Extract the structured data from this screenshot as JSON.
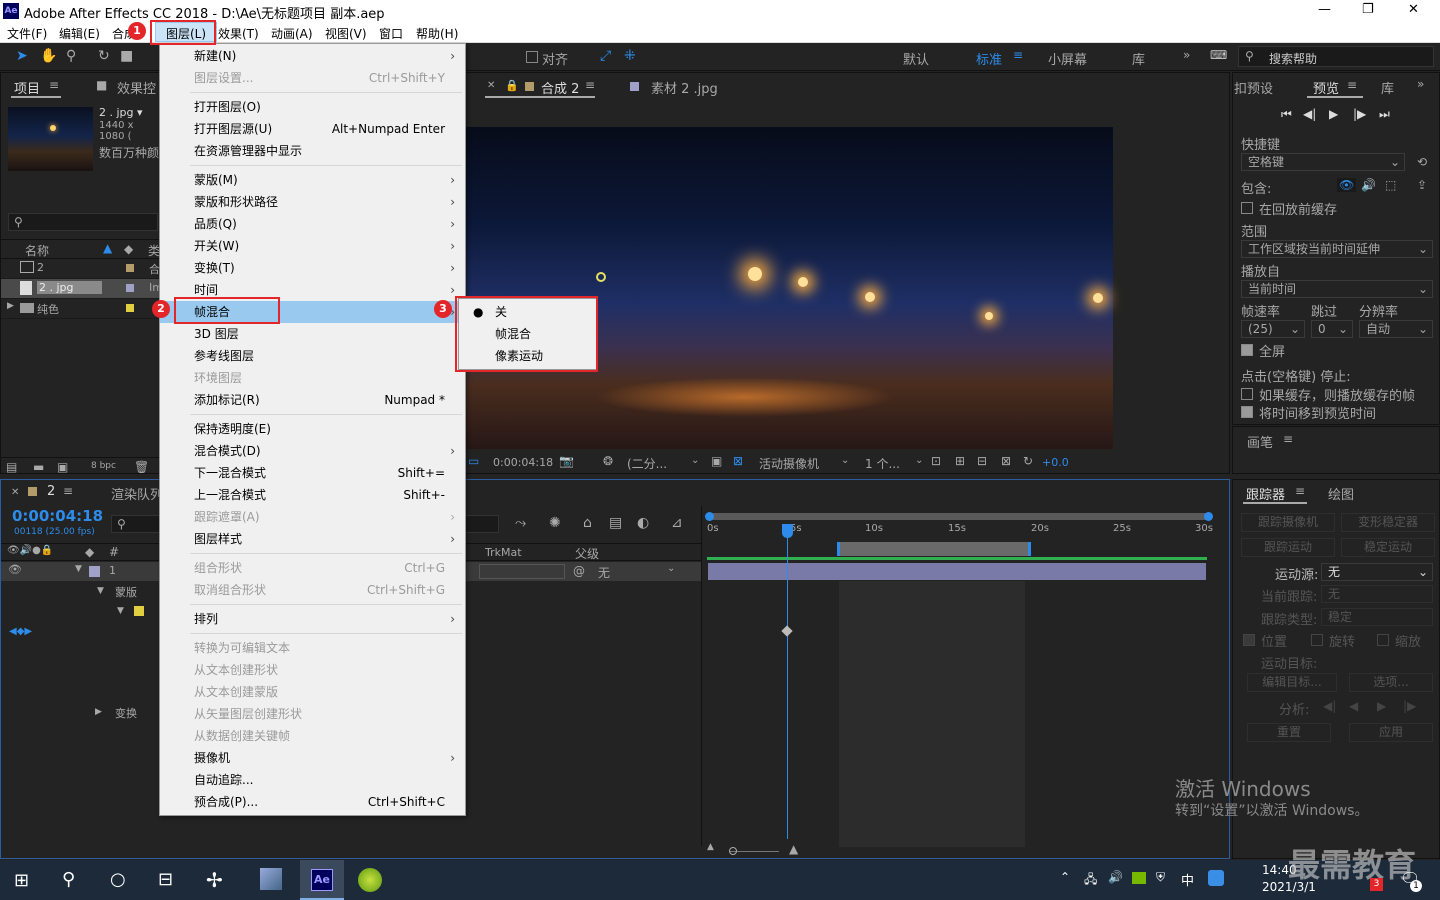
{
  "window": {
    "title": "Adobe After Effects CC 2018 - D:\\Ae\\无标题项目 副本.aep",
    "app_icon": "Ae",
    "min": "—",
    "max": "❐",
    "close": "✕"
  },
  "menubar": [
    "文件(F)",
    "编辑(E)",
    "合成",
    "图层(L)",
    "效果(T)",
    "动画(A)",
    "视图(V)",
    "窗口",
    "帮助(H)"
  ],
  "toolbar": {
    "snap_label": "对齐",
    "workspaces": [
      "默认",
      "标准",
      "小屏幕",
      "库"
    ],
    "search_placeholder": "搜索帮助"
  },
  "project": {
    "tab_project": "项目",
    "tab_effects": "效果控",
    "thumb_name": "2 . jpg ▾",
    "thumb_dims": "1440 x 1080 (",
    "thumb_desc": "数百万种颜",
    "col_name": "名称",
    "col_type": "类",
    "rows": [
      {
        "name": "2",
        "type": "合"
      },
      {
        "name": "2 . jpg",
        "type": "Im"
      },
      {
        "name": "纯色",
        "type": ""
      }
    ],
    "bpc": "8 bpc"
  },
  "comp": {
    "tab1": "合成 2",
    "tab2": "素材 2 .jpg",
    "timecode": "0:00:04:18",
    "resolution": "(二分...",
    "camera": "活动摄像机",
    "views": "1 个...",
    "exposure": "+0.0"
  },
  "timeline": {
    "tab": "2",
    "tab2": "渲染队列",
    "timecode": "0:00:04:18",
    "frames": "00118 (25.00 fps)",
    "col_trkmat": "TrkMat",
    "col_parent": "父级",
    "layer_num": "1",
    "parent_value": "无",
    "sub_mask": "蒙版",
    "sub_transform": "变换",
    "ruler": [
      "0s",
      "5s",
      "10s",
      "15s",
      "20s",
      "25s",
      "30s"
    ]
  },
  "layer_menu": {
    "items": [
      {
        "label": "新建(N)",
        "shortcut": "",
        "arrow": true,
        "disabled": false
      },
      {
        "label": "图层设置...",
        "shortcut": "Ctrl+Shift+Y",
        "arrow": false,
        "disabled": true
      },
      {
        "label": "打开图层(O)",
        "shortcut": "",
        "arrow": false,
        "disabled": false
      },
      {
        "label": "打开图层源(U)",
        "shortcut": "Alt+Numpad Enter",
        "arrow": false,
        "disabled": false
      },
      {
        "label": "在资源管理器中显示",
        "shortcut": "",
        "arrow": false,
        "disabled": false
      },
      {
        "label": "蒙版(M)",
        "shortcut": "",
        "arrow": true,
        "disabled": false
      },
      {
        "label": "蒙版和形状路径",
        "shortcut": "",
        "arrow": true,
        "disabled": false
      },
      {
        "label": "品质(Q)",
        "shortcut": "",
        "arrow": true,
        "disabled": false
      },
      {
        "label": "开关(W)",
        "shortcut": "",
        "arrow": true,
        "disabled": false
      },
      {
        "label": "变换(T)",
        "shortcut": "",
        "arrow": true,
        "disabled": false
      },
      {
        "label": "时间",
        "shortcut": "",
        "arrow": true,
        "disabled": false
      },
      {
        "label": "帧混合",
        "shortcut": "",
        "arrow": true,
        "disabled": false
      },
      {
        "label": "3D 图层",
        "shortcut": "",
        "arrow": false,
        "disabled": false
      },
      {
        "label": "参考线图层",
        "shortcut": "",
        "arrow": false,
        "disabled": false
      },
      {
        "label": "环境图层",
        "shortcut": "",
        "arrow": false,
        "disabled": true
      },
      {
        "label": "添加标记(R)",
        "shortcut": "Numpad *",
        "arrow": false,
        "disabled": false
      },
      {
        "label": "保持透明度(E)",
        "shortcut": "",
        "arrow": false,
        "disabled": false
      },
      {
        "label": "混合模式(D)",
        "shortcut": "",
        "arrow": true,
        "disabled": false
      },
      {
        "label": "下一混合模式",
        "shortcut": "Shift+=",
        "arrow": false,
        "disabled": false
      },
      {
        "label": "上一混合模式",
        "shortcut": "Shift+-",
        "arrow": false,
        "disabled": false
      },
      {
        "label": "跟踪遮罩(A)",
        "shortcut": "",
        "arrow": true,
        "disabled": true
      },
      {
        "label": "图层样式",
        "shortcut": "",
        "arrow": true,
        "disabled": false
      },
      {
        "label": "组合形状",
        "shortcut": "Ctrl+G",
        "arrow": false,
        "disabled": true
      },
      {
        "label": "取消组合形状",
        "shortcut": "Ctrl+Shift+G",
        "arrow": false,
        "disabled": true
      },
      {
        "label": "排列",
        "shortcut": "",
        "arrow": true,
        "disabled": false
      },
      {
        "label": "转换为可编辑文本",
        "shortcut": "",
        "arrow": false,
        "disabled": true
      },
      {
        "label": "从文本创建形状",
        "shortcut": "",
        "arrow": false,
        "disabled": true
      },
      {
        "label": "从文本创建蒙版",
        "shortcut": "",
        "arrow": false,
        "disabled": true
      },
      {
        "label": "从矢量图层创建形状",
        "shortcut": "",
        "arrow": false,
        "disabled": true
      },
      {
        "label": "从数据创建关键帧",
        "shortcut": "",
        "arrow": false,
        "disabled": true
      },
      {
        "label": "摄像机",
        "shortcut": "",
        "arrow": true,
        "disabled": false
      },
      {
        "label": "自动追踪...",
        "shortcut": "",
        "arrow": false,
        "disabled": false
      },
      {
        "label": "预合成(P)...",
        "shortcut": "Ctrl+Shift+C",
        "arrow": false,
        "disabled": false
      }
    ]
  },
  "frame_blend_submenu": [
    "关",
    "帧混合",
    "像素运动"
  ],
  "badges": [
    "1",
    "2",
    "3"
  ],
  "preview": {
    "tab_presets": "扣预设",
    "tab_preview": "预览",
    "tab_lib": "库",
    "shortcut_label": "快捷键",
    "shortcut_value": "空格键",
    "include_label": "包含:",
    "cache_label": "在回放前缓存",
    "range_label": "范围",
    "range_value": "工作区域按当前时间延伸",
    "playfrom_label": "播放自",
    "playfrom_value": "当前时间",
    "fps_label": "帧速率",
    "skip_label": "跳过",
    "res_label": "分辨率",
    "fps_value": "(25)",
    "skip_value": "0",
    "res_value": "自动",
    "fullscreen_label": "全屏",
    "stop_label": "点击(空格键) 停止:",
    "opt1": "如果缓存，则播放缓存的帧",
    "opt2": "将时间移到预览时间",
    "brush_tab": "画笔"
  },
  "tracker": {
    "tab": "跟踪器",
    "tab2": "绘图",
    "btn_track_camera": "跟踪摄像机",
    "btn_warp": "变形稳定器",
    "btn_track_motion": "跟踪运动",
    "btn_stabilize": "稳定运动",
    "source_label": "运动源:",
    "source_value": "无",
    "current_label": "当前跟踪:",
    "current_value": "无",
    "type_label": "跟踪类型:",
    "type_value": "稳定",
    "pos": "位置",
    "rot": "旋转",
    "scale": "缩放",
    "target_label": "运动目标:",
    "edit_target": "编辑目标...",
    "options": "选项...",
    "analyze": "分析:",
    "reset": "重置",
    "apply": "应用"
  },
  "watermark": {
    "line1": "激活 Windows",
    "line2": "转到“设置”以激活 Windows。",
    "brand": "最需教育"
  },
  "taskbar": {
    "time": "14:40",
    "date": "2021/3/1",
    "ime": "中",
    "notif_count": "1",
    "mail_count": "3"
  },
  "colors": {
    "accent_blue": "#2d8ceb",
    "highlight": "#99c9ef",
    "red_box": "#e3262a",
    "timecode": "#2d8ceb"
  }
}
